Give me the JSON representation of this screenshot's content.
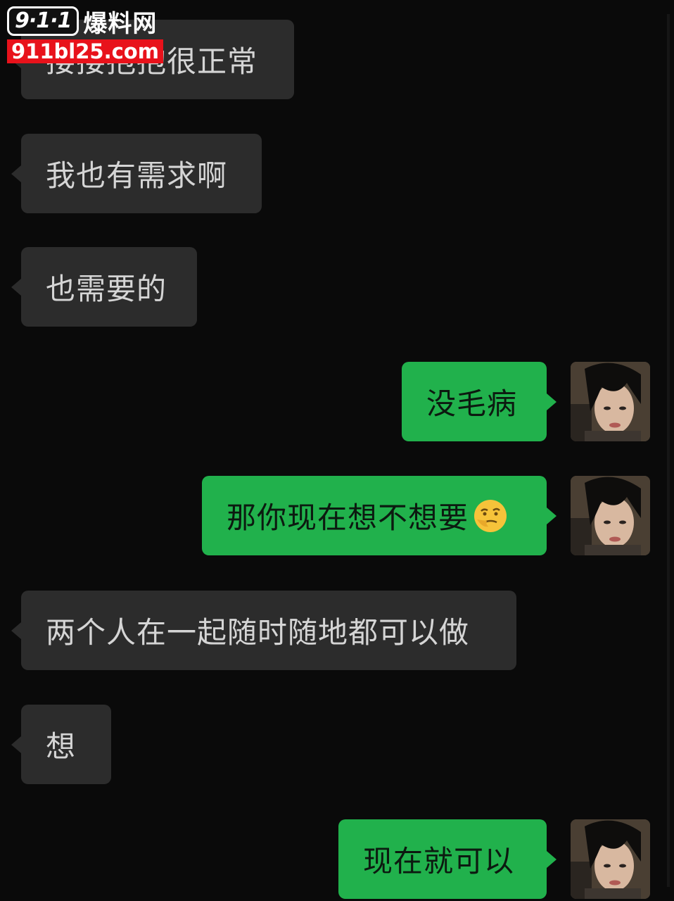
{
  "watermark": {
    "logo": "9·1·1",
    "name": "爆料网",
    "url": "911bl25.com"
  },
  "messages": [
    {
      "side": "left",
      "text": "搂搂抱抱很正常"
    },
    {
      "side": "left",
      "text": "我也有需求啊"
    },
    {
      "side": "left",
      "text": "也需要的"
    },
    {
      "side": "right",
      "text": "没毛病"
    },
    {
      "side": "right",
      "text": "那你现在想不想要",
      "emoji": "smirk-emoji"
    },
    {
      "side": "left",
      "text": "两个人在一起随时随地都可以做"
    },
    {
      "side": "left",
      "text": "想"
    },
    {
      "side": "right",
      "text": "现在就可以"
    }
  ],
  "colors": {
    "background": "#0a0a0a",
    "incoming_bubble": "#2c2c2c",
    "outgoing_bubble": "#21b14c",
    "watermark_red": "#e8121b"
  }
}
